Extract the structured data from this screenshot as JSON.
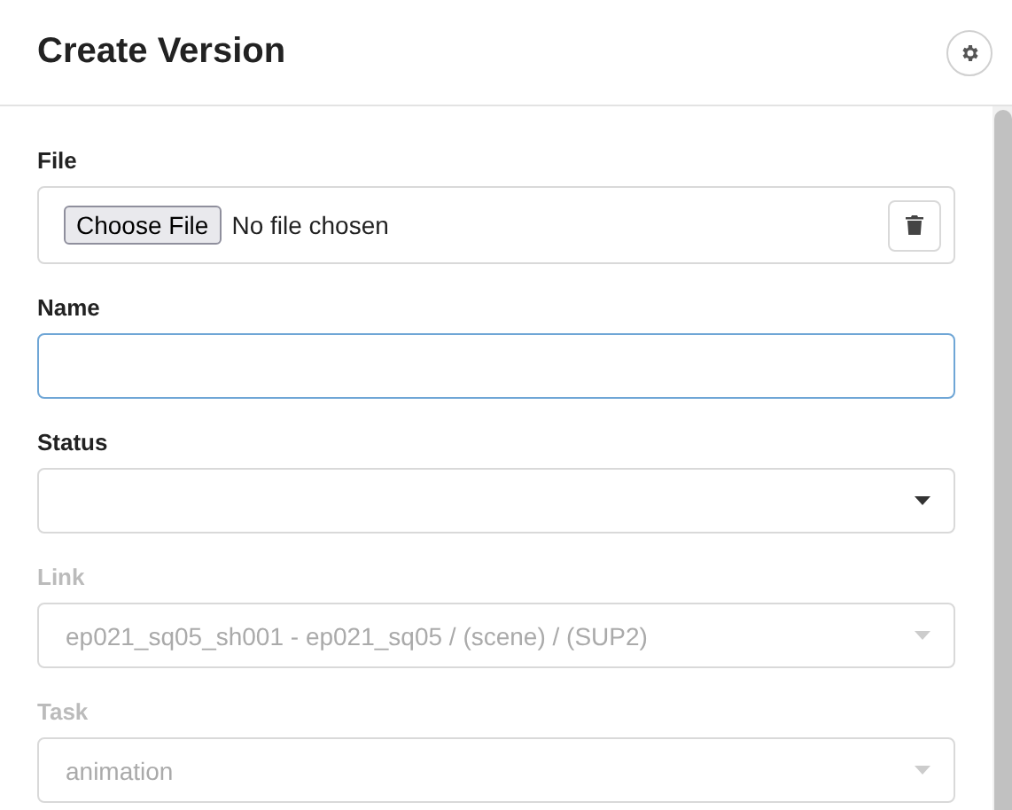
{
  "window": {
    "title": "Create Version"
  },
  "fields": [
    {
      "kind": "file",
      "label": "File",
      "disabled": false,
      "button": "Choose File",
      "value": "No file chosen"
    },
    {
      "kind": "text",
      "label": "Name",
      "disabled": false,
      "focused": true
    },
    {
      "kind": "select",
      "label": "Status",
      "disabled": false
    },
    {
      "kind": "select",
      "label": "Link",
      "disabled": true,
      "value": "ep021_sq05_sh001 - ep021_sq05 / (scene) / (SUP2)"
    },
    {
      "kind": "select",
      "label": "Task",
      "disabled": true,
      "value": "animation"
    }
  ]
}
